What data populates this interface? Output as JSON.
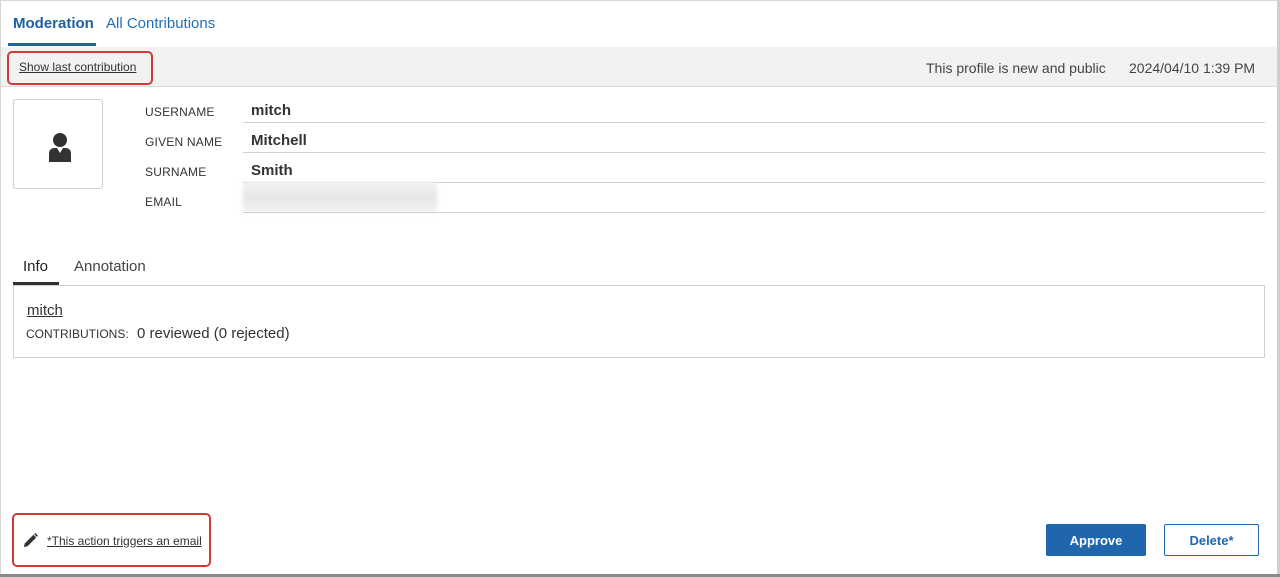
{
  "top_tabs": {
    "moderation": "Moderation",
    "all_contributions": "All Contributions"
  },
  "toolbar": {
    "show_last_contribution": "Show last contribution",
    "status": "This profile is new and public",
    "timestamp": "2024/04/10 1:39 PM"
  },
  "profile": {
    "avatar_icon": "user-silhouette-icon",
    "fields": [
      {
        "label": "USERNAME",
        "value": "mitch"
      },
      {
        "label": "GIVEN NAME",
        "value": "Mitchell"
      },
      {
        "label": "SURNAME",
        "value": "Smith"
      },
      {
        "label": "EMAIL",
        "value": ""
      }
    ]
  },
  "inner_tabs": {
    "info": "Info",
    "annotation": "Annotation"
  },
  "info": {
    "username_link": "mitch",
    "contributions_label": "CONTRIBUTIONS:",
    "contributions_value": "0 reviewed (0 rejected)"
  },
  "footer": {
    "edit_icon": "pencil-icon",
    "email_note": "*This action triggers an email",
    "approve_label": "Approve",
    "delete_label": "Delete*"
  },
  "colors": {
    "accent": "#1f66ad",
    "highlight": "#d23a3a"
  }
}
